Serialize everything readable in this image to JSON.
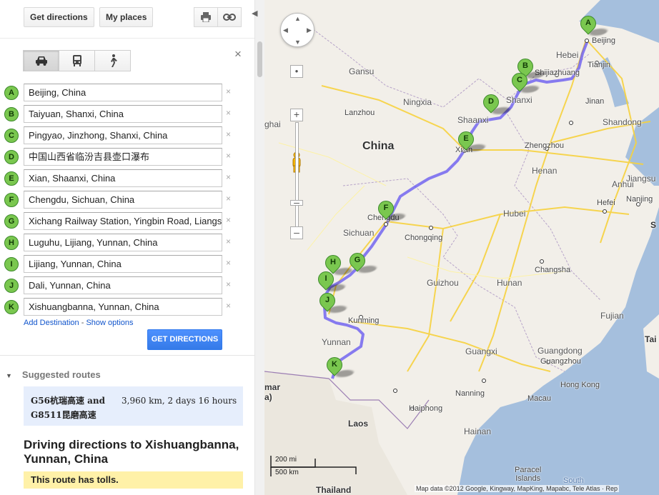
{
  "toolbar": {
    "get_directions": "Get directions",
    "my_places": "My places",
    "print_icon": "print-icon",
    "link_icon": "link-icon"
  },
  "travel_modes": [
    {
      "name": "car-icon",
      "active": true
    },
    {
      "name": "transit-icon",
      "active": false
    },
    {
      "name": "walk-icon",
      "active": false
    }
  ],
  "close_symbol": "×",
  "waypoints": [
    {
      "letter": "A",
      "value": "Beijing, China"
    },
    {
      "letter": "B",
      "value": "Taiyuan, Shanxi, China"
    },
    {
      "letter": "C",
      "value": "Pingyao, Jinzhong, Shanxi, China"
    },
    {
      "letter": "D",
      "value": "中国山西省临汾吉县壶口瀑布"
    },
    {
      "letter": "E",
      "value": "Xian, Shaanxi, China"
    },
    {
      "letter": "F",
      "value": "Chengdu, Sichuan, China"
    },
    {
      "letter": "G",
      "value": "Xichang Railway Station, Yingbin Road, Liangs"
    },
    {
      "letter": "H",
      "value": "Luguhu, Lijiang, Yunnan, China"
    },
    {
      "letter": "I",
      "value": "Lijiang, Yunnan, China"
    },
    {
      "letter": "J",
      "value": "Dali, Yunnan, China"
    },
    {
      "letter": "K",
      "value": "Xishuangbanna, Yunnan, China"
    }
  ],
  "remove_symbol": "×",
  "links": {
    "add_destination": "Add Destination",
    "separator": " - ",
    "show_options": "Show options"
  },
  "get_directions_button": "GET DIRECTIONS",
  "suggested": {
    "heading": "Suggested routes",
    "route_name": "G56杭瑞高速 and G8511昆磨高速",
    "route_stats": "3,960 km, 2 days 16 hours"
  },
  "directions_title": "Driving directions to Xishuangbanna, Yunnan, China",
  "tolls_notice": "This route has tolls.",
  "map": {
    "labels": {
      "beijing": "Beijing",
      "hebei": "Hebei",
      "tianjin": "Tianjin",
      "shijiazhuang": "Shijiazhuang",
      "shanxi": "Shanxi",
      "gansu": "Gansu",
      "ningxia": "Ningxia",
      "lanzhou": "Lanzhou",
      "jinan": "Jinan",
      "shandong": "Shandong",
      "ghai": "ghai",
      "china": "China",
      "shaanxi": "Shaanxi",
      "xian": "Xi'an",
      "zhengzhou": "Zhengzhou",
      "henan": "Henan",
      "jiangsu": "Jiangsu",
      "anhui": "Anhui",
      "chengdu": "Chengdu",
      "hubei": "Hubei",
      "hefei": "Hefei",
      "nanjing": "Nanjing",
      "sichuan": "Sichuan",
      "chongqing": "Chongqing",
      "changsha": "Changsha",
      "guizhou": "Guizhou",
      "hunan": "Hunan",
      "kunming": "Kunming",
      "yunnan": "Yunnan",
      "guangxi": "Guangxi",
      "guangdong": "Guangdong",
      "guangzhou": "Guangzhou",
      "fujian": "Fujian",
      "hongkong": "Hong Kong",
      "macau": "Macau",
      "nanning": "Nanning",
      "haiphong": "Haiphong",
      "laos": "Laos",
      "hainan": "Hainan",
      "paracel": "Paracel\nIslands",
      "south": "South",
      "thailand": "Thailand",
      "myanmar": "mar\na)",
      "taiwan": "Tai",
      "shanghai_s": "S"
    },
    "scale_top": "200 mi",
    "scale_bottom": "500 km",
    "copyright": "Map data ©2012 Google, Kingway, MapKing, Mapabc, Tele Atlas · Rep"
  }
}
